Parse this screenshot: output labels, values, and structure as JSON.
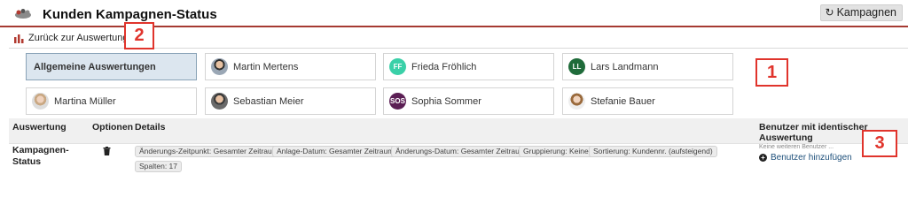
{
  "header": {
    "title": "Kunden Kampagnen-Status",
    "campaigns_button": "Kampagnen"
  },
  "back_link": "Zurück zur Auswertung",
  "callouts": [
    "1",
    "2",
    "3"
  ],
  "users": [
    {
      "label": "Allgemeine Auswertungen",
      "avatar": "none",
      "active": true
    },
    {
      "label": "Martin Mertens",
      "avatar": "photo"
    },
    {
      "label": "Frieda Fröhlich",
      "avatar": "FF",
      "color": "#3ad0a8"
    },
    {
      "label": "Lars Landmann",
      "avatar": "LL",
      "color": "#1f6b3a"
    },
    {
      "label": "Martina Müller",
      "avatar": "photo"
    },
    {
      "label": "Sebastian Meier",
      "avatar": "photo"
    },
    {
      "label": "Sophia Sommer",
      "avatar": "SOS",
      "color": "#5b1e54"
    },
    {
      "label": "Stefanie Bauer",
      "avatar": "photo"
    }
  ],
  "table": {
    "headers": {
      "auswertung": "Auswertung",
      "optionen": "Optionen",
      "details": "Details",
      "benutzer": "Benutzer mit identischer Auswertung"
    },
    "row": {
      "name": "Kampagnen-Status",
      "details": [
        "Änderungs-Zeitpunkt: Gesamter Zeitraum",
        "Anlage-Datum: Gesamter Zeitraum",
        "Änderungs-Datum: Gesamter Zeitraum",
        "Gruppierung: Keine",
        "Sortierung: Kundennr. (aufsteigend)",
        "Spalten: 17"
      ],
      "no_users": "Keine weiteren Benutzer ...",
      "add_user": "Benutzer hinzufügen"
    }
  },
  "colors": {
    "accent_line": "#a63a32",
    "callout": "#e0342c",
    "active_tile": "#dce6ef",
    "link": "#1d4f7a"
  }
}
